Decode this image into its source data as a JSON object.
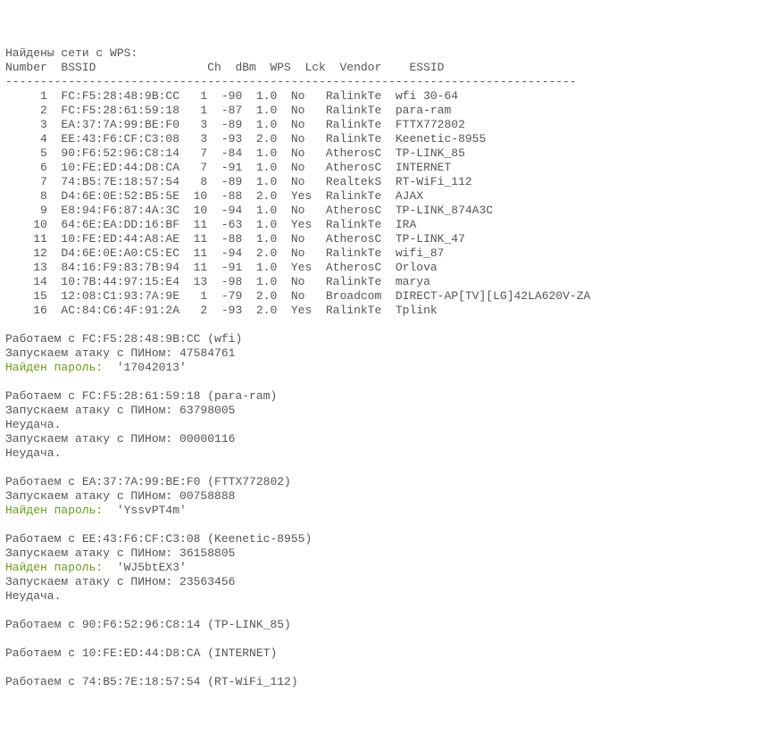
{
  "header": "Найдены сети с WPS:",
  "columns_line": "Number  BSSID                Ch  dBm  WPS  Lck  Vendor    ESSID",
  "dash_line": "----------------------------------------------------------------------------------",
  "networks": [
    {
      "num": 1,
      "bssid": "FC:F5:28:48:9B:CC",
      "ch": 1,
      "dbm": -90,
      "wps": "1.0",
      "lck": "No",
      "vendor": "RalinkTe",
      "essid": "wfi 30-64"
    },
    {
      "num": 2,
      "bssid": "FC:F5:28:61:59:18",
      "ch": 1,
      "dbm": -87,
      "wps": "1.0",
      "lck": "No",
      "vendor": "RalinkTe",
      "essid": "para-ram"
    },
    {
      "num": 3,
      "bssid": "EA:37:7A:99:BE:F0",
      "ch": 3,
      "dbm": -89,
      "wps": "1.0",
      "lck": "No",
      "vendor": "RalinkTe",
      "essid": "FTTX772802"
    },
    {
      "num": 4,
      "bssid": "EE:43:F6:CF:C3:08",
      "ch": 3,
      "dbm": -93,
      "wps": "2.0",
      "lck": "No",
      "vendor": "RalinkTe",
      "essid": "Keenetic-8955"
    },
    {
      "num": 5,
      "bssid": "90:F6:52:96:C8:14",
      "ch": 7,
      "dbm": -84,
      "wps": "1.0",
      "lck": "No",
      "vendor": "AtherosC",
      "essid": "TP-LINK_85"
    },
    {
      "num": 6,
      "bssid": "10:FE:ED:44:D8:CA",
      "ch": 7,
      "dbm": -91,
      "wps": "1.0",
      "lck": "No",
      "vendor": "AtherosC",
      "essid": "INTERNET"
    },
    {
      "num": 7,
      "bssid": "74:B5:7E:18:57:54",
      "ch": 8,
      "dbm": -89,
      "wps": "1.0",
      "lck": "No",
      "vendor": "RealtekS",
      "essid": "RT-WiFi_112"
    },
    {
      "num": 8,
      "bssid": "D4:6E:0E:52:B5:5E",
      "ch": 10,
      "dbm": -88,
      "wps": "2.0",
      "lck": "Yes",
      "vendor": "RalinkTe",
      "essid": "AJAX"
    },
    {
      "num": 9,
      "bssid": "E8:94:F6:87:4A:3C",
      "ch": 10,
      "dbm": -94,
      "wps": "1.0",
      "lck": "No",
      "vendor": "AtherosC",
      "essid": "TP-LINK_874A3C"
    },
    {
      "num": 10,
      "bssid": "64:6E:EA:DD:16:BF",
      "ch": 11,
      "dbm": -63,
      "wps": "1.0",
      "lck": "Yes",
      "vendor": "RalinkTe",
      "essid": "IRA"
    },
    {
      "num": 11,
      "bssid": "10:FE:ED:44:A8:AE",
      "ch": 11,
      "dbm": -88,
      "wps": "1.0",
      "lck": "No",
      "vendor": "AtherosC",
      "essid": "TP-LINK_47"
    },
    {
      "num": 12,
      "bssid": "D4:6E:0E:A0:C5:EC",
      "ch": 11,
      "dbm": -94,
      "wps": "2.0",
      "lck": "No",
      "vendor": "RalinkTe",
      "essid": "wifi_87"
    },
    {
      "num": 13,
      "bssid": "84:16:F9:83:7B:94",
      "ch": 11,
      "dbm": -91,
      "wps": "1.0",
      "lck": "Yes",
      "vendor": "AtherosC",
      "essid": "Orlova"
    },
    {
      "num": 14,
      "bssid": "10:7B:44:97:15:E4",
      "ch": 13,
      "dbm": -98,
      "wps": "1.0",
      "lck": "No",
      "vendor": "RalinkTe",
      "essid": "marya"
    },
    {
      "num": 15,
      "bssid": "12:08:C1:93:7A:9E",
      "ch": 1,
      "dbm": -79,
      "wps": "2.0",
      "lck": "No",
      "vendor": "Broadcom",
      "essid": "DIRECT-AP[TV][LG]42LA620V-ZA"
    },
    {
      "num": 16,
      "bssid": "AC:84:C6:4F:91:2A",
      "ch": 2,
      "dbm": -93,
      "wps": "2.0",
      "lck": "Yes",
      "vendor": "RalinkTe",
      "essid": "Tplink"
    }
  ],
  "log": [
    {
      "type": "blank"
    },
    {
      "type": "line",
      "text": "Работаем с FC:F5:28:48:9B:CC (wfi)"
    },
    {
      "type": "line",
      "text": "Запускаем атаку с ПИНом: 47584761"
    },
    {
      "type": "success",
      "label": "Найден пароль:",
      "value": "  '17042013'"
    },
    {
      "type": "blank"
    },
    {
      "type": "line",
      "text": "Работаем с FC:F5:28:61:59:18 (para-ram)"
    },
    {
      "type": "line",
      "text": "Запускаем атаку с ПИНом: 63798005"
    },
    {
      "type": "line",
      "text": "Неудача."
    },
    {
      "type": "line",
      "text": "Запускаем атаку с ПИНом: 00000116"
    },
    {
      "type": "line",
      "text": "Неудача."
    },
    {
      "type": "blank"
    },
    {
      "type": "line",
      "text": "Работаем с EA:37:7A:99:BE:F0 (FTTX772802)"
    },
    {
      "type": "line",
      "text": "Запускаем атаку с ПИНом: 00758888"
    },
    {
      "type": "success",
      "label": "Найден пароль:",
      "value": "  'YssvPT4m'"
    },
    {
      "type": "blank"
    },
    {
      "type": "line",
      "text": "Работаем с EE:43:F6:CF:C3:08 (Keenetic-8955)"
    },
    {
      "type": "line",
      "text": "Запускаем атаку с ПИНом: 36158805"
    },
    {
      "type": "success",
      "label": "Найден пароль:",
      "value": "  'WJ5btEX3'"
    },
    {
      "type": "line",
      "text": "Запускаем атаку с ПИНом: 23563456"
    },
    {
      "type": "line",
      "text": "Неудача."
    },
    {
      "type": "blank"
    },
    {
      "type": "line",
      "text": "Работаем с 90:F6:52:96:C8:14 (TP-LINK_85)"
    },
    {
      "type": "blank"
    },
    {
      "type": "line",
      "text": "Работаем с 10:FE:ED:44:D8:CA (INTERNET)"
    },
    {
      "type": "blank"
    },
    {
      "type": "line",
      "text": "Работаем с 74:B5:7E:18:57:54 (RT-WiFi_112)"
    }
  ]
}
